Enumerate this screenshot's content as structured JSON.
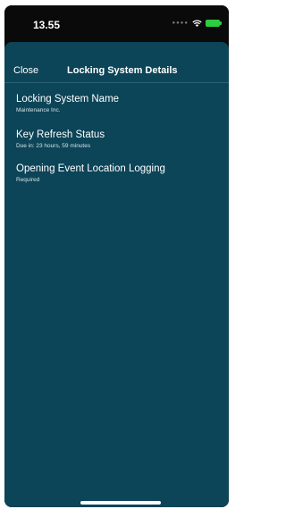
{
  "status_bar": {
    "time": "13.55",
    "signal_icon": "signal-dots-icon",
    "wifi_icon": "wifi-icon",
    "battery_icon": "battery-charging-icon",
    "battery_color": "#2ecc40"
  },
  "nav": {
    "close_label": "Close",
    "title": "Locking System Details"
  },
  "details": [
    {
      "label": "Locking System Name",
      "value": "Maintenance Inc."
    },
    {
      "label": "Key Refresh Status",
      "value": "Due in: 23 hours, 59 minutes"
    },
    {
      "label": "Opening Event Location Logging",
      "value": "Required"
    }
  ],
  "colors": {
    "sheet_background": "#0c4458",
    "status_background": "#0a0a0a",
    "text": "#ffffff"
  }
}
